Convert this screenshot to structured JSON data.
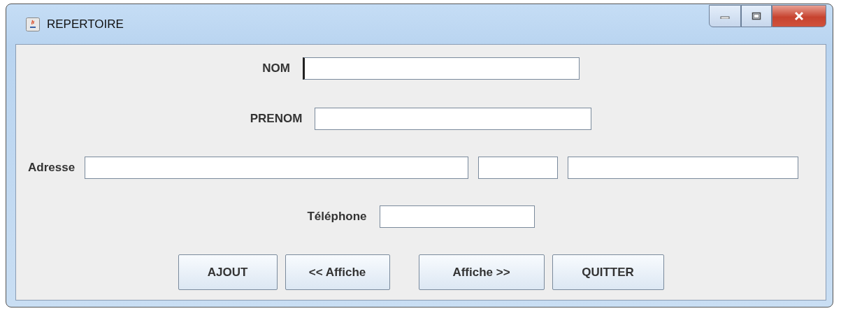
{
  "window": {
    "title": "REPERTOIRE"
  },
  "rows": [
    {
      "kind": "single",
      "label": "NOM",
      "focused": true
    },
    {
      "kind": "single",
      "label": "PRENOM",
      "focused": false
    },
    {
      "kind": "address",
      "label": "Adresse",
      "focused": false
    },
    {
      "kind": "single",
      "label": "Téléphone",
      "focused": false
    }
  ],
  "buttons": [
    "AJOUT",
    "<< Affiche",
    "Affiche >>",
    "QUITTER"
  ]
}
